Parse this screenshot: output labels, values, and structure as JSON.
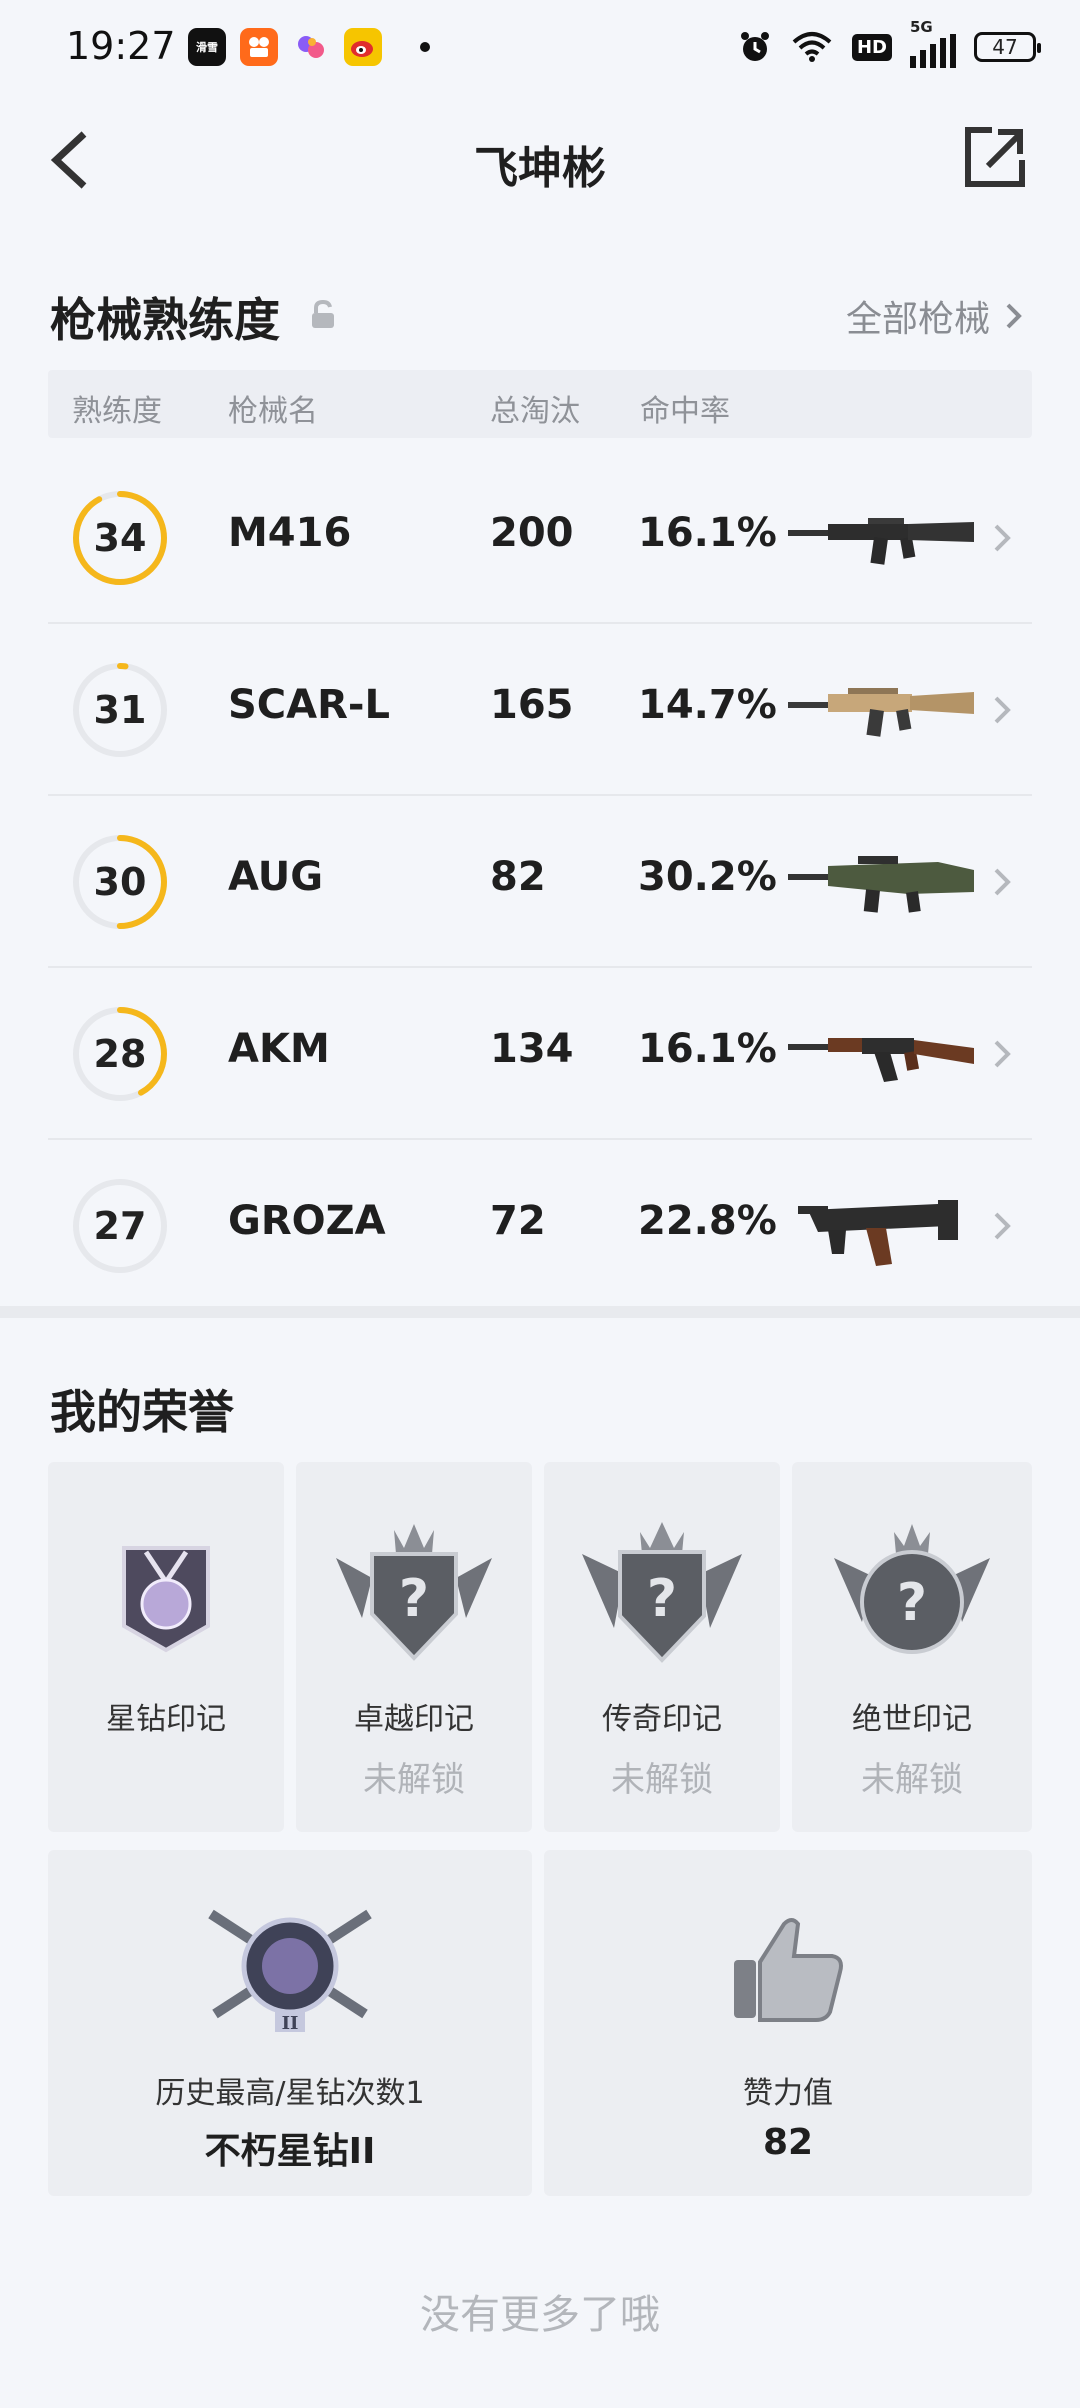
{
  "status_bar": {
    "time": "19:27",
    "network": "5G",
    "hd_label": "HD",
    "battery": "47",
    "app_icons": [
      "滑雪",
      "快手",
      "小宇宙",
      "微博"
    ]
  },
  "header": {
    "title": "飞坤彬"
  },
  "weapons": {
    "section_title": "枪械熟练度",
    "all_link": "全部枪械",
    "columns": [
      "熟练度",
      "枪械名",
      "总淘汰",
      "命中率"
    ],
    "rows": [
      {
        "level": "34",
        "name": "M416",
        "kills": "200",
        "rate": "16.1%",
        "progress": 0.92
      },
      {
        "level": "31",
        "name": "SCAR-L",
        "kills": "165",
        "rate": "14.7%",
        "progress": 0.02
      },
      {
        "level": "30",
        "name": "AUG",
        "kills": "82",
        "rate": "30.2%",
        "progress": 0.5
      },
      {
        "level": "28",
        "name": "AKM",
        "kills": "134",
        "rate": "16.1%",
        "progress": 0.42
      },
      {
        "level": "27",
        "name": "GROZA",
        "kills": "72",
        "rate": "22.8%",
        "progress": 0.0
      }
    ]
  },
  "honors": {
    "section_title": "我的荣誉",
    "cards": [
      {
        "label": "星钻印记",
        "status": ""
      },
      {
        "label": "卓越印记",
        "status": "未解锁"
      },
      {
        "label": "传奇印记",
        "status": "未解锁"
      },
      {
        "label": "绝世印记",
        "status": "未解锁"
      }
    ],
    "rank_card": {
      "label": "历史最高/星钻次数1",
      "value": "不朽星钻II"
    },
    "likes_card": {
      "label": "赞力值",
      "value": "82"
    }
  },
  "footer": {
    "no_more": "没有更多了哦"
  },
  "colors": {
    "accent": "#f5b71b",
    "ring_track": "#e6e8ec"
  }
}
